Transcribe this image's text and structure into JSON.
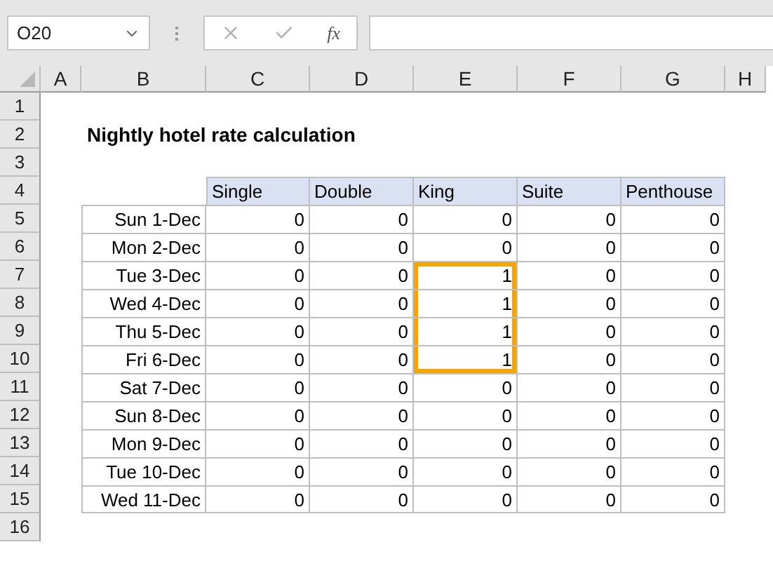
{
  "name_box": {
    "value": "O20"
  },
  "formula_bar": {
    "fx_label": "fx"
  },
  "column_headers": [
    "A",
    "B",
    "C",
    "D",
    "E",
    "F",
    "G",
    "H"
  ],
  "title_row": {
    "header": "2",
    "text": "Nightly hotel rate calculation"
  },
  "empty_rows": [
    "1",
    "3"
  ],
  "table": {
    "header": "4",
    "columns": [
      "Single",
      "Double",
      "King",
      "Suite",
      "Penthouse"
    ],
    "rows": [
      {
        "header": "5",
        "label": "Sun 1-Dec",
        "cells": [
          {
            "value": "0",
            "outlined": false
          },
          {
            "value": "0",
            "outlined": false
          },
          {
            "value": "0",
            "outlined": false
          },
          {
            "value": "0",
            "outlined": false
          },
          {
            "value": "0",
            "outlined": false
          }
        ]
      },
      {
        "header": "6",
        "label": "Mon 2-Dec",
        "cells": [
          {
            "value": "0",
            "outlined": false
          },
          {
            "value": "0",
            "outlined": false
          },
          {
            "value": "0",
            "outlined": false
          },
          {
            "value": "0",
            "outlined": false
          },
          {
            "value": "0",
            "outlined": false
          }
        ]
      },
      {
        "header": "7",
        "label": "Tue 3-Dec",
        "cells": [
          {
            "value": "0",
            "outlined": false
          },
          {
            "value": "0",
            "outlined": false
          },
          {
            "value": "1",
            "outlined": true
          },
          {
            "value": "0",
            "outlined": false
          },
          {
            "value": "0",
            "outlined": false
          }
        ]
      },
      {
        "header": "8",
        "label": "Wed 4-Dec",
        "cells": [
          {
            "value": "0",
            "outlined": false
          },
          {
            "value": "0",
            "outlined": false
          },
          {
            "value": "1",
            "outlined": true
          },
          {
            "value": "0",
            "outlined": false
          },
          {
            "value": "0",
            "outlined": false
          }
        ]
      },
      {
        "header": "9",
        "label": "Thu 5-Dec",
        "cells": [
          {
            "value": "0",
            "outlined": false
          },
          {
            "value": "0",
            "outlined": false
          },
          {
            "value": "1",
            "outlined": true
          },
          {
            "value": "0",
            "outlined": false
          },
          {
            "value": "0",
            "outlined": false
          }
        ]
      },
      {
        "header": "10",
        "label": "Fri 6-Dec",
        "cells": [
          {
            "value": "0",
            "outlined": false
          },
          {
            "value": "0",
            "outlined": false
          },
          {
            "value": "1",
            "outlined": true
          },
          {
            "value": "0",
            "outlined": false
          },
          {
            "value": "0",
            "outlined": false
          }
        ]
      },
      {
        "header": "11",
        "label": "Sat 7-Dec",
        "cells": [
          {
            "value": "0",
            "outlined": false
          },
          {
            "value": "0",
            "outlined": false
          },
          {
            "value": "0",
            "outlined": false
          },
          {
            "value": "0",
            "outlined": false
          },
          {
            "value": "0",
            "outlined": false
          }
        ]
      },
      {
        "header": "12",
        "label": "Sun 8-Dec",
        "cells": [
          {
            "value": "0",
            "outlined": false
          },
          {
            "value": "0",
            "outlined": false
          },
          {
            "value": "0",
            "outlined": false
          },
          {
            "value": "0",
            "outlined": false
          },
          {
            "value": "0",
            "outlined": false
          }
        ]
      },
      {
        "header": "13",
        "label": "Mon 9-Dec",
        "cells": [
          {
            "value": "0",
            "outlined": false
          },
          {
            "value": "0",
            "outlined": false
          },
          {
            "value": "0",
            "outlined": false
          },
          {
            "value": "0",
            "outlined": false
          },
          {
            "value": "0",
            "outlined": false
          }
        ]
      },
      {
        "header": "14",
        "label": "Tue 10-Dec",
        "cells": [
          {
            "value": "0",
            "outlined": false
          },
          {
            "value": "0",
            "outlined": false
          },
          {
            "value": "0",
            "outlined": false
          },
          {
            "value": "0",
            "outlined": false
          },
          {
            "value": "0",
            "outlined": false
          }
        ]
      },
      {
        "header": "15",
        "label": "Wed 11-Dec",
        "cells": [
          {
            "value": "0",
            "outlined": false
          },
          {
            "value": "0",
            "outlined": false
          },
          {
            "value": "0",
            "outlined": false
          },
          {
            "value": "0",
            "outlined": false
          },
          {
            "value": "0",
            "outlined": false
          }
        ]
      }
    ]
  },
  "trailing_rows": [
    "16"
  ]
}
